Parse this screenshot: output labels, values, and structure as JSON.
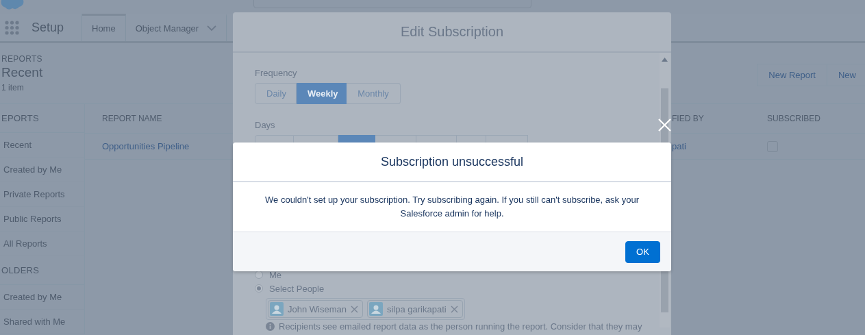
{
  "app_bar": {
    "app_name": "Setup",
    "tabs": [
      {
        "label": "Home",
        "selected": true
      },
      {
        "label": "Object Manager",
        "selected": false
      }
    ]
  },
  "page_header": {
    "eyebrow": "REPORTS",
    "title": "Recent",
    "count": "1 item",
    "buttons": [
      "New Report",
      "New"
    ]
  },
  "sidebar": {
    "sections": [
      {
        "heading": "EPORTS",
        "items": [
          "Recent",
          "Created by Me",
          "Private Reports",
          "Public Reports",
          "All Reports"
        ]
      },
      {
        "heading": "OLDERS",
        "items": [
          "Created by Me",
          "Shared with Me"
        ]
      }
    ]
  },
  "table": {
    "columns": [
      "REPORT NAME",
      "FIED BY",
      "SUBSCRIBED"
    ],
    "rows": [
      {
        "report_name": "Opportunities Pipeline",
        "column_2": "pati",
        "subscribed": false
      }
    ]
  },
  "edit_subscription": {
    "title": "Edit Subscription",
    "frequency": {
      "label": "Frequency",
      "options": [
        {
          "label": "Daily",
          "selected": false
        },
        {
          "label": "Weekly",
          "selected": true
        },
        {
          "label": "Monthly",
          "selected": false
        }
      ]
    },
    "days": {
      "label": "Days",
      "options": [
        {
          "selected": false
        },
        {
          "selected": false
        },
        {
          "selected": true
        },
        {
          "selected": false
        },
        {
          "selected": false
        },
        {
          "selected": false
        },
        {
          "selected": false
        }
      ]
    },
    "recipients": [
      {
        "label": "Me",
        "selected": false
      },
      {
        "label": "Select People",
        "selected": true
      }
    ],
    "people": [
      "John Wiseman",
      "silpa garikapati"
    ],
    "info": "Recipients see emailed report data as the person running the report. Consider that they may"
  },
  "alert": {
    "title": "Subscription unsuccessful",
    "message": "We couldn't set up your subscription. Try subscribing again. If you still can't subscribe, ask your Salesforce admin for help.",
    "button": "OK"
  }
}
